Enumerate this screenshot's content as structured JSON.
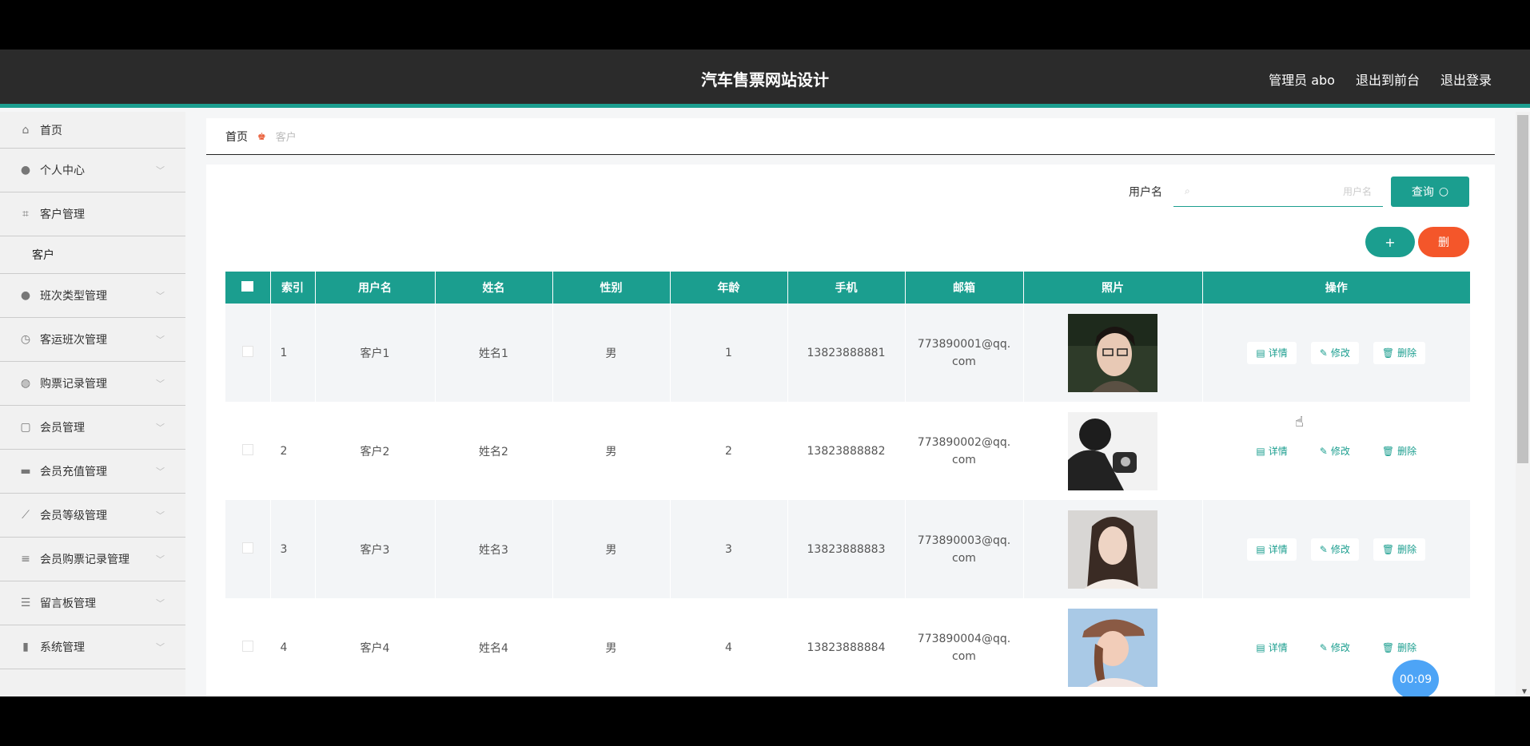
{
  "header": {
    "title": "汽车售票网站设计",
    "admin": "管理员 abo",
    "back_front": "退出到前台",
    "logout": "退出登录"
  },
  "sidebar": {
    "items": [
      {
        "label": "首页",
        "icon": "home-icon"
      },
      {
        "label": "个人中心",
        "icon": "user-icon"
      },
      {
        "label": "客户管理",
        "icon": "frame-icon"
      },
      {
        "label": "班次类型管理",
        "icon": "user-icon"
      },
      {
        "label": "客运班次管理",
        "icon": "clock-icon"
      },
      {
        "label": "购票记录管理",
        "icon": "globe-icon"
      },
      {
        "label": "会员管理",
        "icon": "box-icon"
      },
      {
        "label": "会员充值管理",
        "icon": "card-icon"
      },
      {
        "label": "会员等级管理",
        "icon": "chart-icon"
      },
      {
        "label": "会员购票记录管理",
        "icon": "list-icon"
      },
      {
        "label": "留言板管理",
        "icon": "sliders-icon"
      },
      {
        "label": "系统管理",
        "icon": "bars-icon"
      }
    ],
    "sub_item": "客户"
  },
  "breadcrumb": {
    "home": "首页",
    "current": "客户"
  },
  "search": {
    "label": "用户名",
    "placeholder": "用户名",
    "button": "查询"
  },
  "actions": {
    "add": "+",
    "delete": "删"
  },
  "table": {
    "headers": [
      "索引",
      "用户名",
      "姓名",
      "性别",
      "年龄",
      "手机",
      "邮箱",
      "照片",
      "操作"
    ],
    "rows": [
      {
        "index": "1",
        "username": "客户1",
        "name": "姓名1",
        "gender": "男",
        "age": "1",
        "phone": "13823888881",
        "email1": "773890001@qq.",
        "email2": "com"
      },
      {
        "index": "2",
        "username": "客户2",
        "name": "姓名2",
        "gender": "男",
        "age": "2",
        "phone": "13823888882",
        "email1": "773890002@qq.",
        "email2": "com"
      },
      {
        "index": "3",
        "username": "客户3",
        "name": "姓名3",
        "gender": "男",
        "age": "3",
        "phone": "13823888883",
        "email1": "773890003@qq.",
        "email2": "com"
      },
      {
        "index": "4",
        "username": "客户4",
        "name": "姓名4",
        "gender": "男",
        "age": "4",
        "phone": "13823888884",
        "email1": "773890004@qq.",
        "email2": "com"
      }
    ],
    "ops": {
      "detail": "详情",
      "edit": "修改",
      "delete": "删除"
    }
  },
  "timer": "00:09",
  "colors": {
    "accent": "#1b9e8f",
    "danger": "#f4562a",
    "topbar": "#2b2b2b"
  }
}
